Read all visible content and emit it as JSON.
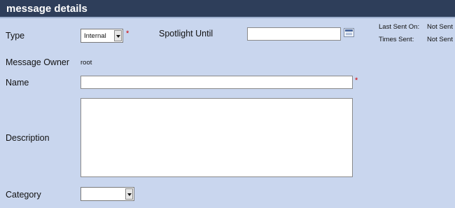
{
  "header": {
    "title": "message details"
  },
  "type": {
    "label": "Type",
    "value": "Internal"
  },
  "spotlight": {
    "label": "Spotlight Until",
    "value": ""
  },
  "stats": {
    "last_sent_label": "Last Sent On:",
    "last_sent_value": "Not Sent",
    "times_sent_label": "Times Sent:",
    "times_sent_value": "Not Sent"
  },
  "owner": {
    "label": "Message Owner",
    "value": "root"
  },
  "name": {
    "label": "Name",
    "value": ""
  },
  "description": {
    "label": "Description",
    "value": ""
  },
  "category": {
    "label": "Category",
    "value": ""
  },
  "required_marker": "*",
  "colors": {
    "header_bg": "#2e3e5a",
    "page_bg": "#c9d6ee",
    "required": "#d00000"
  },
  "icons": {
    "spotlight_picker": "calendar-icon",
    "dropdown": "chevron-down-icon"
  }
}
